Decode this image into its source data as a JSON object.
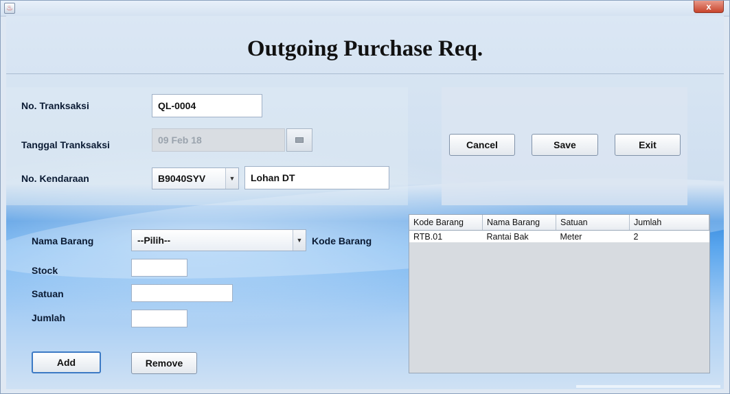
{
  "window": {
    "close_label": "x"
  },
  "header": {
    "title": "Outgoing Purchase Req."
  },
  "form": {
    "no_transaksi_label": "No. Tranksaksi",
    "no_transaksi_value": "QL-0004",
    "tanggal_label": "Tanggal Tranksaksi",
    "tanggal_value": "09 Feb 18",
    "kendaraan_label": "No. Kendaraan",
    "kendaraan_value": "B9040SYV",
    "driver_value": "Lohan DT"
  },
  "actions": {
    "cancel": "Cancel",
    "save": "Save",
    "exit": "Exit"
  },
  "item_form": {
    "nama_barang_label": "Nama Barang",
    "nama_barang_value": "--Pilih--",
    "kode_barang_label": "Kode Barang",
    "stock_label": "Stock",
    "satuan_label": "Satuan",
    "jumlah_label": "Jumlah",
    "add_label": "Add",
    "remove_label": "Remove"
  },
  "table": {
    "headers": [
      "Kode Barang",
      "Nama Barang",
      "Satuan",
      "Jumlah"
    ],
    "rows": [
      [
        "RTB.01",
        "Rantai Bak",
        "Meter",
        "2"
      ]
    ]
  }
}
